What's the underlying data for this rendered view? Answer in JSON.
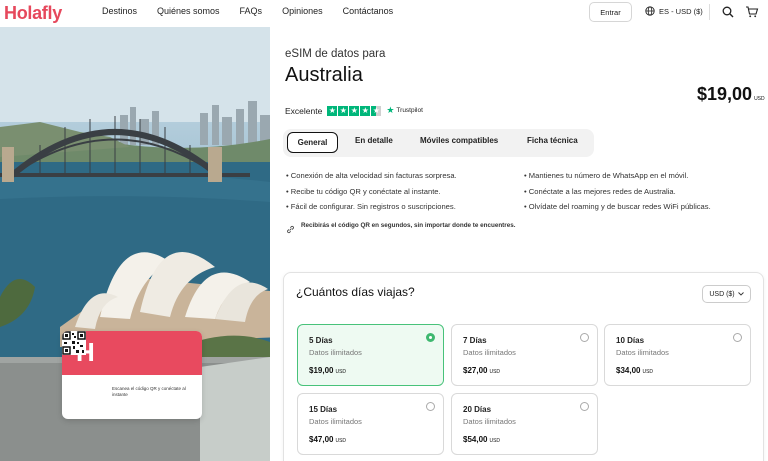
{
  "brand": {
    "name": "Holafly",
    "color": "#e6485c"
  },
  "nav": {
    "items": [
      "Destinos",
      "Quiénes somos",
      "FAQs",
      "Opiniones",
      "Contáctanos"
    ]
  },
  "header": {
    "login_label": "Entrar",
    "locale_label": "ES - USD ($)",
    "icons": [
      "globe-icon",
      "search-icon",
      "cart-icon"
    ]
  },
  "esim_card": {
    "logo_letter": "H",
    "caption": "Escanea el código QR y conéctate al instante"
  },
  "product": {
    "subtitle": "eSIM de datos para",
    "title": "Australia",
    "price": "$19,00",
    "currency": "USD",
    "rating_label": "Excelente",
    "rating_stars": 4.5,
    "rating_source": "Trustpilot",
    "rating_color": "#00b67a"
  },
  "tabs": [
    "General",
    "En detalle",
    "Móviles compatibles",
    "Ficha técnica"
  ],
  "features": {
    "left": [
      "Conexión de alta velocidad sin facturas sorpresa.",
      "Recibe tu código QR y conéctate al instante.",
      "Fácil de configurar. Sin registros o suscripciones."
    ],
    "right": [
      "Mantienes tu número de WhatsApp en el móvil.",
      "Conéctate a las mejores redes de Australia.",
      "Olvídate del roaming y de buscar redes WiFi públicas."
    ]
  },
  "qr_note": "Recibirás el código QR en segundos, sin importar donde te encuentres.",
  "days": {
    "title": "¿Cuántos días viajas?",
    "currency_select": "USD ($)",
    "plans": [
      {
        "name": "5 Días",
        "desc": "Datos ilimitados",
        "price": "$19,00",
        "currency": "USD",
        "selected": true
      },
      {
        "name": "7 Días",
        "desc": "Datos ilimitados",
        "price": "$27,00",
        "currency": "USD",
        "selected": false
      },
      {
        "name": "10 Días",
        "desc": "Datos ilimitados",
        "price": "$34,00",
        "currency": "USD",
        "selected": false
      },
      {
        "name": "15 Días",
        "desc": "Datos ilimitados",
        "price": "$47,00",
        "currency": "USD",
        "selected": false
      },
      {
        "name": "20 Días",
        "desc": "Datos ilimitados",
        "price": "$54,00",
        "currency": "USD",
        "selected": false
      }
    ],
    "selected_color": "#48c27a"
  }
}
